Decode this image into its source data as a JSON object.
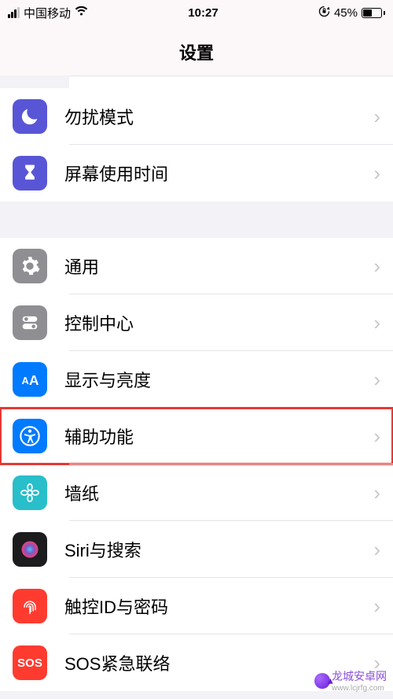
{
  "status": {
    "carrier": "中国移动",
    "time": "10:27",
    "battery_pct": "45%"
  },
  "header": {
    "title": "设置"
  },
  "group1": [
    {
      "key": "dnd",
      "label": "勿扰模式",
      "bg": "bg-purple"
    },
    {
      "key": "screentime",
      "label": "屏幕使用时间",
      "bg": "bg-purple"
    }
  ],
  "group2": [
    {
      "key": "general",
      "label": "通用",
      "bg": "bg-gray"
    },
    {
      "key": "control",
      "label": "控制中心",
      "bg": "bg-gray"
    },
    {
      "key": "display",
      "label": "显示与亮度",
      "bg": "bg-blue"
    },
    {
      "key": "accessibility",
      "label": "辅助功能",
      "bg": "bg-blue",
      "highlight": true
    },
    {
      "key": "wallpaper",
      "label": "墙纸",
      "bg": "bg-teal"
    },
    {
      "key": "siri",
      "label": "Siri与搜索",
      "bg": "bg-black"
    },
    {
      "key": "touchid",
      "label": "触控ID与密码",
      "bg": "bg-red"
    },
    {
      "key": "sos",
      "label": "SOS紧急联络",
      "bg": "bg-sos"
    }
  ],
  "watermark": {
    "main": "龙城安卓网",
    "sub": "www.lcjrfg.com"
  }
}
